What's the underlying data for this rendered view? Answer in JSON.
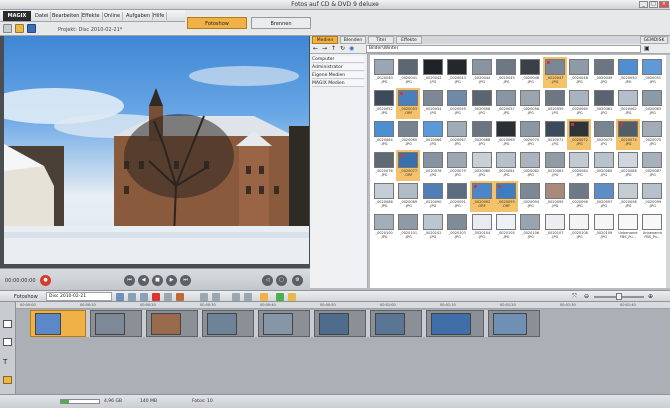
{
  "window": {
    "title": "Fotos auf CD & DVD 9 deluxe"
  },
  "menu": {
    "logo": "MAGIX",
    "items": [
      "Datei",
      "Bearbeiten",
      "Effekte",
      "Online",
      "Aufgaben",
      "Hilfe"
    ]
  },
  "project": {
    "label": "Projekt: Disc 2010-02-21*"
  },
  "modes": {
    "slideshow": "Fotoshow",
    "burn": "Brennen"
  },
  "preview": {
    "timecode": "00:00:00:00"
  },
  "pool": {
    "tabs": [
      "Medien",
      "Blenden",
      "Titel",
      "Effekte"
    ],
    "extra_tab": "GEMDISK",
    "path": "Bilder\\Winter",
    "tree": [
      "Computer",
      "Administrator",
      "Eigene Medien",
      "MAGIX Medien"
    ]
  },
  "thumbs": [
    {
      "l1": "_0020040",
      "l2": ".JPG",
      "tone": "#9aa6b2",
      "sel": false,
      "flag": false
    },
    {
      "l1": "_0020041",
      "l2": ".JPG",
      "tone": "#5c6672",
      "sel": false,
      "flag": false
    },
    {
      "l1": "_0020042",
      "l2": ".JPG",
      "tone": "#1f2226",
      "sel": false,
      "flag": false
    },
    {
      "l1": "_0020043",
      "l2": ".JPG",
      "tone": "#24282c",
      "sel": false,
      "flag": false
    },
    {
      "l1": "_0020044",
      "l2": ".JPG",
      "tone": "#8894a0",
      "sel": false,
      "flag": false
    },
    {
      "l1": "_0020045",
      "l2": ".JPG",
      "tone": "#6e7884",
      "sel": false,
      "flag": false
    },
    {
      "l1": "_0020046",
      "l2": ".JPG",
      "tone": "#3b4048",
      "sel": false,
      "flag": false
    },
    {
      "l1": "_0020047",
      "l2": ".JPG",
      "tone": "#7a8794",
      "sel": true,
      "flag": true
    },
    {
      "l1": "_0020048",
      "l2": ".JPG",
      "tone": "#8e9aa6",
      "sel": false,
      "flag": false
    },
    {
      "l1": "_0020049",
      "l2": ".JPG",
      "tone": "#6b7682",
      "sel": false,
      "flag": false
    },
    {
      "l1": "_0020050",
      "l2": ".JPG",
      "tone": "#4f8ed0",
      "sel": false,
      "flag": false
    },
    {
      "l1": "_0020051",
      "l2": ".JPG",
      "tone": "#5f9ad6",
      "sel": false,
      "flag": false
    },
    {
      "l1": "_0020052",
      "l2": ".JPG",
      "tone": "#3d4a5a",
      "sel": false,
      "flag": false
    },
    {
      "l1": "_0020053",
      "l2": ".ORF",
      "tone": "#4a7fbe",
      "sel": true,
      "flag": true
    },
    {
      "l1": "_0020054",
      "l2": ".JPG",
      "tone": "#7c8894",
      "sel": false,
      "flag": false
    },
    {
      "l1": "_0020055",
      "l2": ".JPG",
      "tone": "#6f8aa8",
      "sel": false,
      "flag": false
    },
    {
      "l1": "_0020056",
      "l2": ".JPG",
      "tone": "#5a6570",
      "sel": false,
      "flag": false
    },
    {
      "l1": "_0020057",
      "l2": ".JPG",
      "tone": "#8995a2",
      "sel": false,
      "flag": false
    },
    {
      "l1": "_0020058",
      "l2": ".JPG",
      "tone": "#9aa5b0",
      "sel": false,
      "flag": false
    },
    {
      "l1": "_0020059",
      "l2": ".JPG",
      "tone": "#6d7782",
      "sel": false,
      "flag": false
    },
    {
      "l1": "_0020060",
      "l2": ".JPG",
      "tone": "#a7b3bf",
      "sel": false,
      "flag": false
    },
    {
      "l1": "_0020061",
      "l2": ".JPG",
      "tone": "#5a6470",
      "sel": false,
      "flag": false
    },
    {
      "l1": "_0020062",
      "l2": ".JPG",
      "tone": "#b4bec8",
      "sel": false,
      "flag": false
    },
    {
      "l1": "_0020063",
      "l2": ".JPG",
      "tone": "#8d99a5",
      "sel": false,
      "flag": false
    },
    {
      "l1": "_0020064",
      "l2": ".JPG",
      "tone": "#4b8fd2",
      "sel": false,
      "flag": false
    },
    {
      "l1": "_0020065",
      "l2": ".JPG",
      "tone": "#76828e",
      "sel": false,
      "flag": false
    },
    {
      "l1": "_0020066",
      "l2": ".JPG",
      "tone": "#5a9ad8",
      "sel": false,
      "flag": false
    },
    {
      "l1": "_0020067",
      "l2": ".JPG",
      "tone": "#9fabb6",
      "sel": false,
      "flag": false
    },
    {
      "l1": "_0020068",
      "l2": ".JPG",
      "tone": "#6a7580",
      "sel": false,
      "flag": false
    },
    {
      "l1": "_0020069",
      "l2": ".JPG",
      "tone": "#2c3036",
      "sel": false,
      "flag": false
    },
    {
      "l1": "_0020070",
      "l2": ".JPG",
      "tone": "#8b97a3",
      "sel": false,
      "flag": false
    },
    {
      "l1": "_0020071",
      "l2": ".JPG",
      "tone": "#3c4b5c",
      "sel": false,
      "flag": false
    },
    {
      "l1": "_0020072",
      "l2": ".JPG",
      "tone": "#2f3338",
      "sel": true,
      "flag": true
    },
    {
      "l1": "_0020073",
      "l2": ".JPG",
      "tone": "#78848f",
      "sel": false,
      "flag": false
    },
    {
      "l1": "_0020074",
      "l2": ".JPG",
      "tone": "#535d68",
      "sel": true,
      "flag": true
    },
    {
      "l1": "_0020075",
      "l2": ".JPG",
      "tone": "#a1acb7",
      "sel": false,
      "flag": false
    },
    {
      "l1": "_0020076",
      "l2": ".JPG",
      "tone": "#5f6a75",
      "sel": false,
      "flag": false
    },
    {
      "l1": "_0020077",
      "l2": ".ORF",
      "tone": "#3a6fae",
      "sel": true,
      "flag": true
    },
    {
      "l1": "_0020078",
      "l2": ".JPG",
      "tone": "#8793a0",
      "sel": false,
      "flag": false
    },
    {
      "l1": "_0020079",
      "l2": ".JPG",
      "tone": "#9ba7b3",
      "sel": false,
      "flag": false
    },
    {
      "l1": "_0020080",
      "l2": ".JPG",
      "tone": "#c7cfd7",
      "sel": false,
      "flag": false
    },
    {
      "l1": "_0020081",
      "l2": ".JPG",
      "tone": "#b5c0ca",
      "sel": false,
      "flag": false
    },
    {
      "l1": "_0020082",
      "l2": ".JPG",
      "tone": "#a9b4bf",
      "sel": false,
      "flag": false
    },
    {
      "l1": "_0020083",
      "l2": ".JPG",
      "tone": "#8f9ba7",
      "sel": false,
      "flag": false
    },
    {
      "l1": "_0020084",
      "l2": ".JPG",
      "tone": "#c2cbd4",
      "sel": false,
      "flag": false
    },
    {
      "l1": "_0020085",
      "l2": ".JPG",
      "tone": "#b9c3cd",
      "sel": false,
      "flag": false
    },
    {
      "l1": "_0020086",
      "l2": ".JPG",
      "tone": "#d0d7de",
      "sel": false,
      "flag": false
    },
    {
      "l1": "_0020087",
      "l2": ".JPG",
      "tone": "#a6b1bc",
      "sel": false,
      "flag": false
    },
    {
      "l1": "_0020088",
      "l2": ".JPG",
      "tone": "#c5ced7",
      "sel": false,
      "flag": false
    },
    {
      "l1": "_0020089",
      "l2": ".JPG",
      "tone": "#b0bbc5",
      "sel": false,
      "flag": false
    },
    {
      "l1": "_0020090",
      "l2": ".JPG",
      "tone": "#4f7fb4",
      "sel": false,
      "flag": false
    },
    {
      "l1": "_0020091",
      "l2": ".JPG",
      "tone": "#5b6c80",
      "sel": false,
      "flag": false
    },
    {
      "l1": "_0020092",
      "l2": ".ORF",
      "tone": "#4a86c8",
      "sel": true,
      "flag": true
    },
    {
      "l1": "_0020093",
      "l2": ".ORF",
      "tone": "#3f7cc0",
      "sel": true,
      "flag": true
    },
    {
      "l1": "_0020094",
      "l2": ".JPG",
      "tone": "#7c8894",
      "sel": false,
      "flag": false
    },
    {
      "l1": "_0020095",
      "l2": ".JPG",
      "tone": "#a88a7a",
      "sel": false,
      "flag": false
    },
    {
      "l1": "_0020096",
      "l2": ".JPG",
      "tone": "#6d7985",
      "sel": false,
      "flag": false
    },
    {
      "l1": "_0020097",
      "l2": ".JPG",
      "tone": "#5c8ec4",
      "sel": false,
      "flag": false
    },
    {
      "l1": "_0020098",
      "l2": ".JPG",
      "tone": "#c4ccd4",
      "sel": false,
      "flag": false
    },
    {
      "l1": "_0020099",
      "l2": ".JPG",
      "tone": "#b7c1cb",
      "sel": false,
      "flag": false
    },
    {
      "l1": "_0020100",
      "l2": ".JPG",
      "tone": "#a3aeb9",
      "sel": false,
      "flag": false
    },
    {
      "l1": "_0020101",
      "l2": ".JPG",
      "tone": "#8f9aa6",
      "sel": false,
      "flag": false
    },
    {
      "l1": "_0020102",
      "l2": ".JPG",
      "tone": "#bcc6cf",
      "sel": false,
      "flag": false
    },
    {
      "l1": "_0020103",
      "l2": ".JPG",
      "tone": "#7f8b97",
      "sel": false,
      "flag": false
    },
    {
      "l1": "_0020104",
      "l2": ".JPG",
      "tone": "#e8ecf0",
      "sel": false,
      "flag": false
    },
    {
      "l1": "_0020105",
      "l2": ".JPG",
      "tone": "#eef1f4",
      "sel": false,
      "flag": false
    },
    {
      "l1": "_0020106",
      "l2": ".JPG",
      "tone": "#98a4b0",
      "sel": false,
      "flag": false
    },
    {
      "l1": "_0020107",
      "l2": ".JPG",
      "tone": "#eceff2",
      "sel": false,
      "flag": false
    },
    {
      "l1": "_0020108",
      "l2": ".JPG",
      "tone": "#f2f4f6",
      "sel": false,
      "flag": false
    },
    {
      "l1": "_0020109",
      "l2": ".JPG",
      "tone": "#f5f6f8",
      "sel": false,
      "flag": false
    },
    {
      "l1": "Unbenannt",
      "l2": "FBS_Pu...",
      "tone": "#f7f8f9",
      "sel": false,
      "flag": false
    },
    {
      "l1": "Unbenannt",
      "l2": "FBS_Pu...",
      "tone": "#f7f8f9",
      "sel": false,
      "flag": false
    }
  ],
  "editbar": {
    "date": "Disc 2010-02-21"
  },
  "ruler": [
    "00:00:00",
    "00:00:10",
    "00:00:20",
    "00:00:30",
    "00:00:40",
    "00:00:50",
    "00:01:00",
    "00:01:10",
    "00:01:20",
    "00:01:30",
    "00:01:40"
  ],
  "status": {
    "left": "4,96 GB",
    "mid": "140 MB",
    "count": "Fotos: 10"
  },
  "colors": {
    "accent": "#f0b247",
    "selected": "#f3c26a",
    "record": "#d83a2e"
  }
}
